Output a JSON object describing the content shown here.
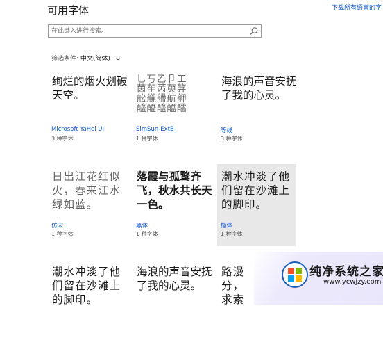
{
  "header": {
    "title": "可用字体",
    "download_link": "下载所有语言的字"
  },
  "search": {
    "placeholder": "在此键入进行搜索。"
  },
  "filter": {
    "label": "筛选条件:",
    "value": "中文(简体)"
  },
  "fonts": [
    {
      "preview": "绚烂的烟火划破天空。",
      "name": "Microsoft YaHei UI",
      "count": "3 种字体"
    },
    {
      "preview": "乚丂乙卩工 茵苼苪萸笄 舩艞艜航舺 醯醯醯醯醽",
      "name": "SimSun-ExtB",
      "count": "1 种字体"
    },
    {
      "preview": "海浪的声音安抚了我的心灵。",
      "name": "等线",
      "count": "3 种字体"
    },
    {
      "preview": "日出江花红似火，春来江水绿如蓝。",
      "name": "仿宋",
      "count": "1 种字体"
    },
    {
      "preview": "落霞与孤鹜齐飞，秋水共长天一色。",
      "name": "黑体",
      "count": "1 种字体"
    },
    {
      "preview": "潮水冲淡了他们留在沙滩上的脚印。",
      "name": "楷体",
      "count": "1 种字体"
    },
    {
      "preview": "潮水冲淡了他们留在沙滩上的脚印。",
      "name": "",
      "count": ""
    },
    {
      "preview": "海浪的声音安抚了我的心灵。",
      "name": "",
      "count": ""
    },
    {
      "preview": "路漫分，求索",
      "name": "",
      "count": ""
    }
  ],
  "watermark": {
    "text": "纯净系统之家",
    "url": "www.ycwjzy.com",
    "logo_colors": [
      "#f25022",
      "#7fba00",
      "#00a4ef",
      "#ffb900"
    ]
  }
}
